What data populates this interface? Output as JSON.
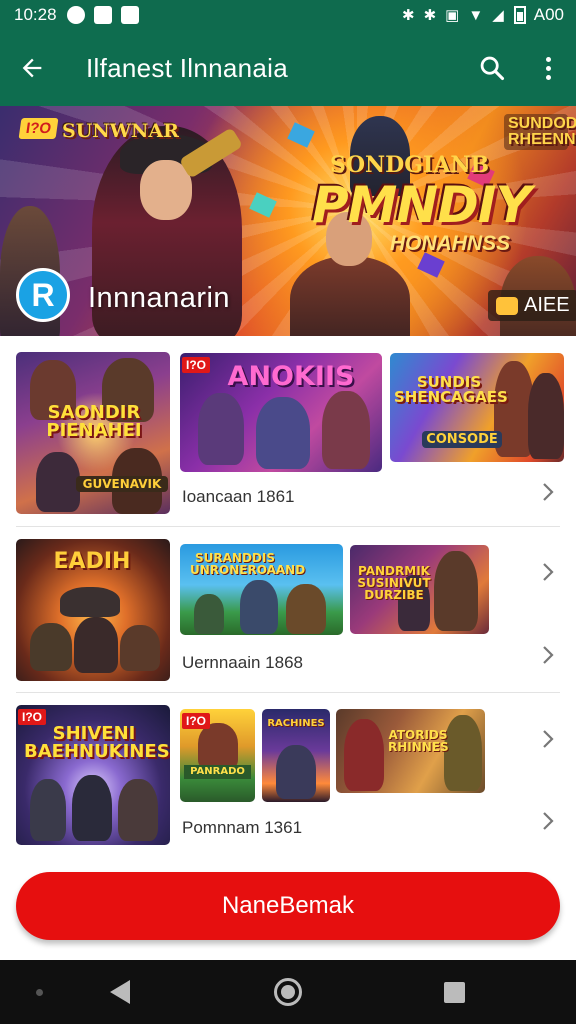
{
  "status_bar": {
    "time": "10:28",
    "battery_text": "A00",
    "icons": [
      "notification-icon",
      "app-notification-icon",
      "app-notification-icon",
      "bluetooth-icon",
      "bluetooth-icon",
      "nfc-icon",
      "wifi-icon",
      "signal-icon",
      "battery-icon"
    ]
  },
  "app_bar": {
    "title": "Ilfanest Ilnnanaia",
    "back_icon": "back-arrow-icon",
    "search_icon": "search-icon",
    "more_icon": "more-vert-icon"
  },
  "hero": {
    "tag": "I?O",
    "small_logo": "SUNWNAR",
    "small_title": "SONDGIANB",
    "big_title": "PMNDIY",
    "subtitle": "HONAHNSS",
    "right_title": "SUNDOD RHEENN",
    "app_icon_letter": "R",
    "app_name": "Innnanarin",
    "badge_text": "AIEE"
  },
  "rows": [
    {
      "label": "Ioancaan 1861",
      "thumbs": [
        {
          "title": "SAONDIR PIENAHEI",
          "subtitle": "GUVENAVIK"
        },
        {
          "tag": "I?O",
          "title": "ANOKIIS"
        },
        {
          "title": "SUNDIS SHENCAGAES",
          "subtitle": "CONSODE"
        }
      ]
    },
    {
      "label": "Uernnaain 1868",
      "thumbs": [
        {
          "title": "EADIH"
        },
        {
          "title": "SURANDDIS UNRONEROAAND"
        },
        {
          "title": "PANDRMIK SUSINIVUT DURZIBE"
        }
      ]
    },
    {
      "label": "Pomnnam 1361",
      "thumbs": [
        {
          "tag": "I?O",
          "title": "SHIVENI BAEHNUKINES"
        },
        {
          "tag": "I?O",
          "title": "PANRADO"
        },
        {
          "title": "RACHINES"
        },
        {
          "title": "ATORIDS RHINNES"
        }
      ]
    }
  ],
  "main_button": {
    "label": "NaneBemak"
  },
  "colors": {
    "app_bar": "#0e6d4f",
    "button": "#e60f0f",
    "nav_bar": "#101010"
  }
}
